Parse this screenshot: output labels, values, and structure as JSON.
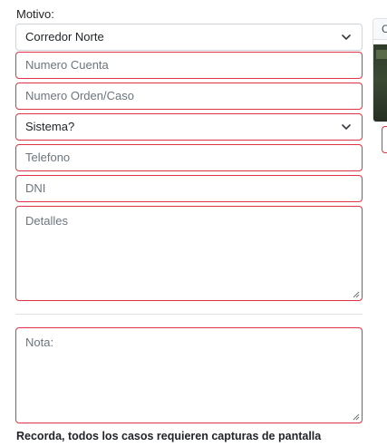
{
  "form": {
    "motivo_label": "Motivo:",
    "motivo_value": "Corredor Norte",
    "numero_cuenta_placeholder": "Numero Cuenta",
    "numero_orden_placeholder": "Numero Orden/Caso",
    "sistema_value": "Sistema?",
    "telefono_placeholder": "Telefono",
    "dni_placeholder": "DNI",
    "detalles_placeholder": "Detalles",
    "nota_placeholder": "Nota:",
    "reminder": "Recorda, todos los casos requieren capturas de pantalla"
  },
  "side_panel": {
    "header_text": "C"
  },
  "colors": {
    "invalid_border": "#dc3545",
    "neutral_border": "#ced4da",
    "placeholder": "#6c757d",
    "text": "#212529"
  },
  "icons": {
    "select_arrow": "chevron-down-icon",
    "resize": "resize-grip-icon"
  }
}
